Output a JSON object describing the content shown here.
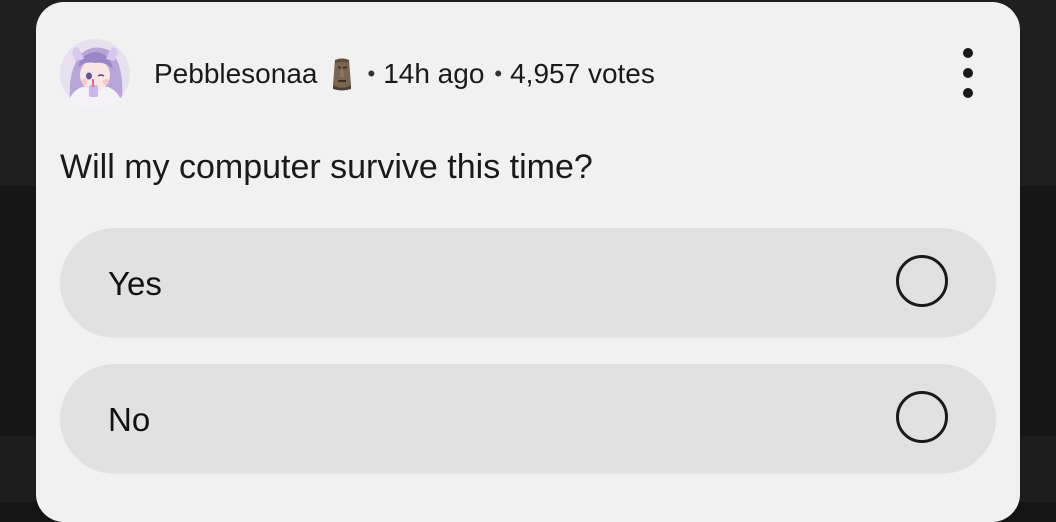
{
  "post": {
    "author": "Pebblesonaa",
    "author_badge_icon": "moai-emoji-icon",
    "separator": "•",
    "time_ago": "14h ago",
    "votes": "4,957 votes",
    "menu_icon": "more-vertical-icon"
  },
  "poll": {
    "question": "Will my computer survive this time?",
    "options": [
      {
        "label": "Yes",
        "selected": false
      },
      {
        "label": "No",
        "selected": false
      }
    ]
  },
  "colors": {
    "card_background": "#f1f1f1",
    "option_background": "#e1e1e1",
    "text": "#1a1a1a",
    "page_background": "#161616"
  }
}
